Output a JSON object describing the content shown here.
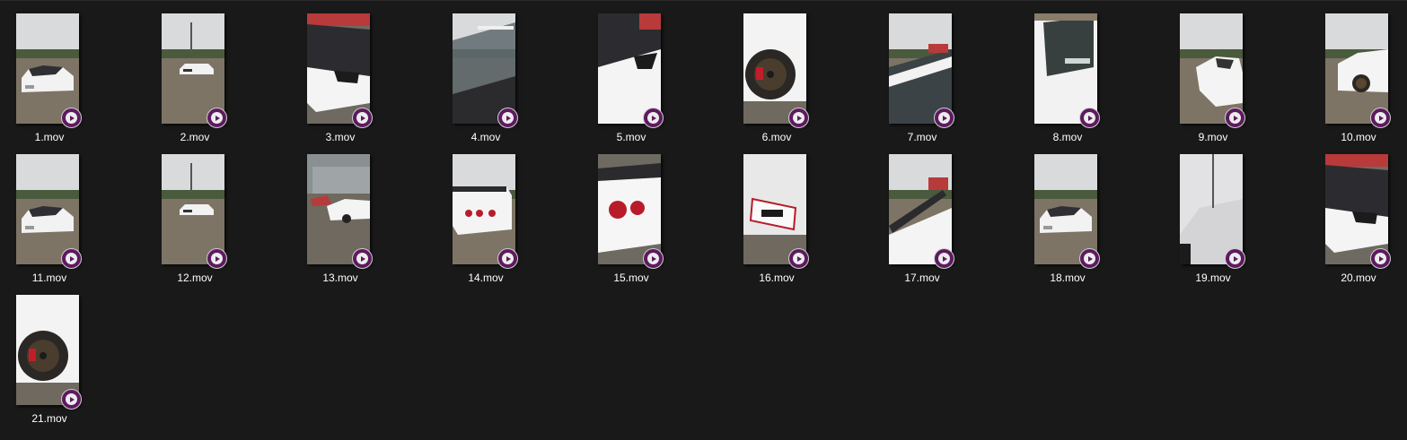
{
  "view": {
    "background": "#191919",
    "play_badge_color": "#5d1a5f",
    "overlay_icon": "play-icon"
  },
  "files": [
    {
      "name": "1.mov"
    },
    {
      "name": "2.mov"
    },
    {
      "name": "3.mov"
    },
    {
      "name": "4.mov"
    },
    {
      "name": "5.mov"
    },
    {
      "name": "6.mov"
    },
    {
      "name": "7.mov"
    },
    {
      "name": "8.mov"
    },
    {
      "name": "9.mov"
    },
    {
      "name": "10.mov"
    },
    {
      "name": "11.mov"
    },
    {
      "name": "12.mov"
    },
    {
      "name": "13.mov"
    },
    {
      "name": "14.mov"
    },
    {
      "name": "15.mov"
    },
    {
      "name": "16.mov"
    },
    {
      "name": "17.mov"
    },
    {
      "name": "18.mov"
    },
    {
      "name": "19.mov"
    },
    {
      "name": "20.mov"
    },
    {
      "name": "21.mov"
    }
  ]
}
